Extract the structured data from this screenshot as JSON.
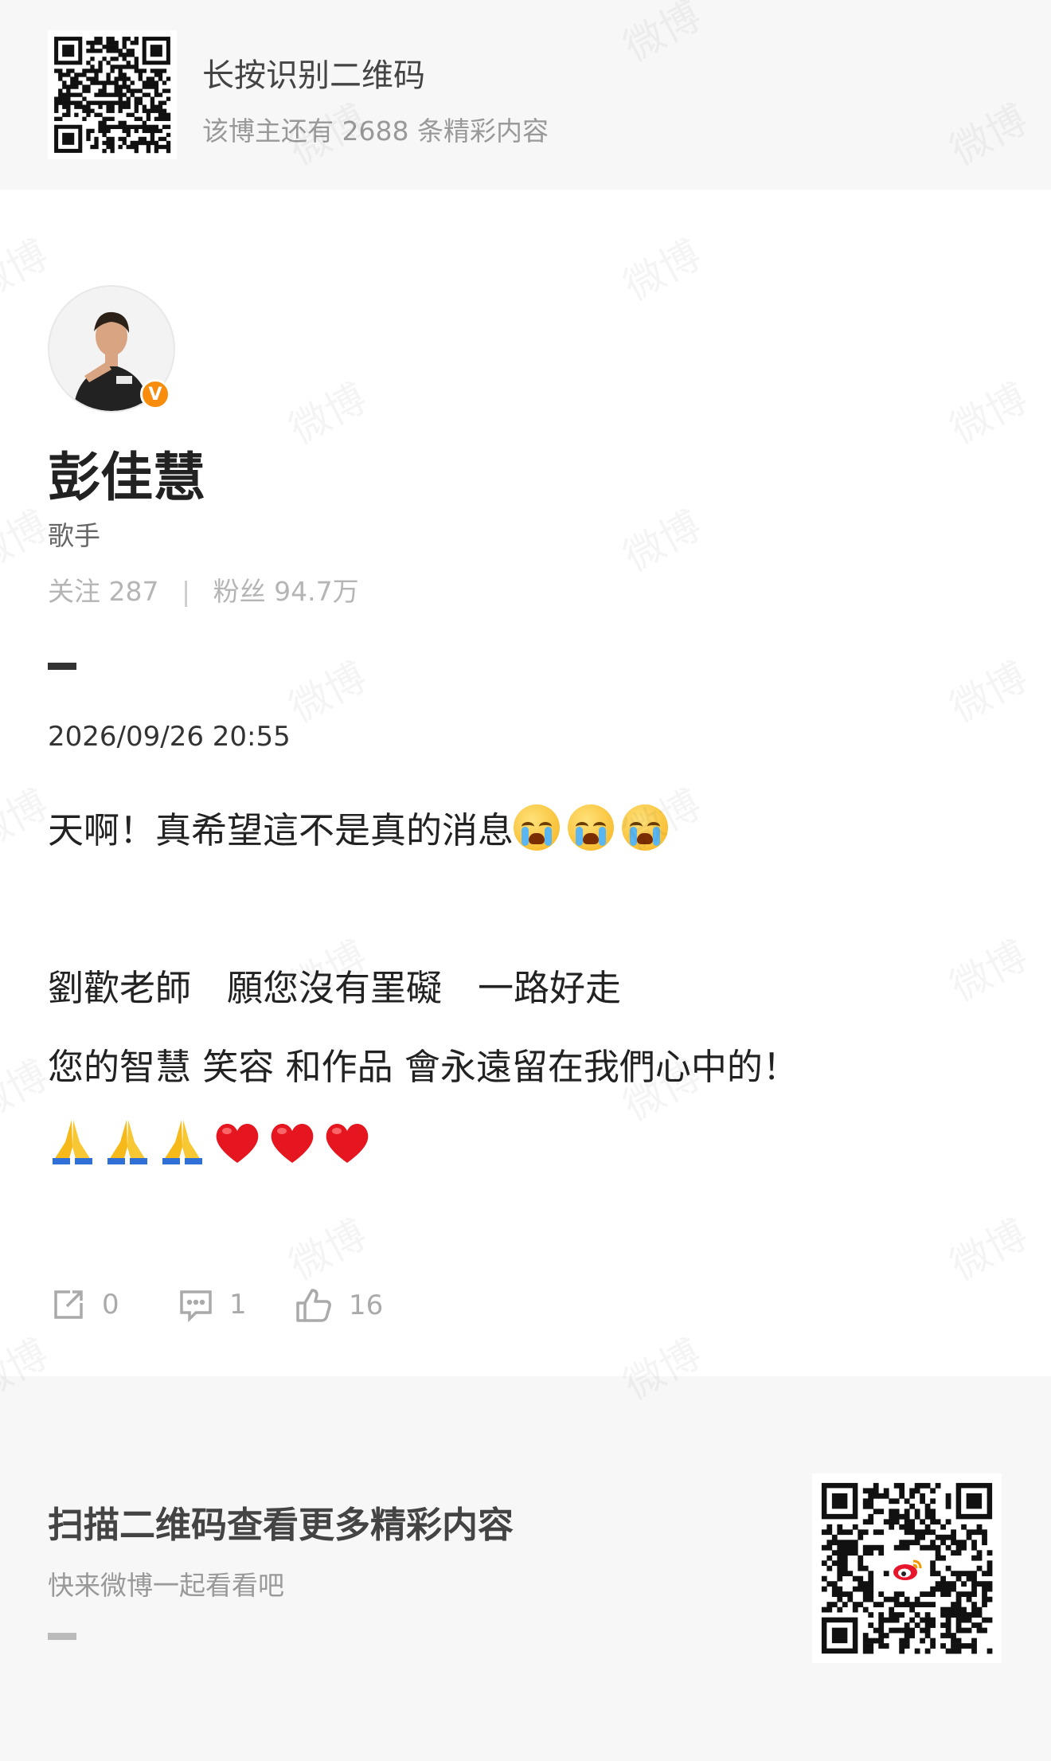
{
  "banner": {
    "title": "长按识别二维码",
    "subtitle": "该博主还有 2688 条精彩内容"
  },
  "profile": {
    "name": "彭佳慧",
    "description": "歌手",
    "verified_badge": "V",
    "following_label": "关注",
    "following_count": "287",
    "separator": "|",
    "followers_label": "粉丝",
    "followers_count": "94.7万"
  },
  "post": {
    "timestamp": "2026/09/26 20:55",
    "line1_text": "天啊！真希望這不是真的消息",
    "line2_text": "劉歡老師　願您沒有罣礙　一路好走",
    "line3_text": "您的智慧 笑容 和作品 會永遠留在我們心中的！",
    "line1_emoji": "loudly-crying-face-icon",
    "line4_emojis": [
      "folded-hands-icon",
      "folded-hands-icon",
      "folded-hands-icon",
      "red-heart-icon",
      "red-heart-icon",
      "red-heart-icon"
    ]
  },
  "actions": {
    "repost_count": "0",
    "comment_count": "1",
    "like_count": "16",
    "repost_icon": "repost-icon",
    "comment_icon": "comment-icon",
    "like_icon": "thumbs-up-icon"
  },
  "footer": {
    "title": "扫描二维码查看更多精彩内容",
    "subtitle": "快来微博一起看看吧"
  },
  "watermark_text": "微博",
  "colors": {
    "banner_bg": "#f7f7f7",
    "verify_orange": "#f78c0d",
    "muted_text": "#999999",
    "action_gray": "#aaaaaa"
  }
}
